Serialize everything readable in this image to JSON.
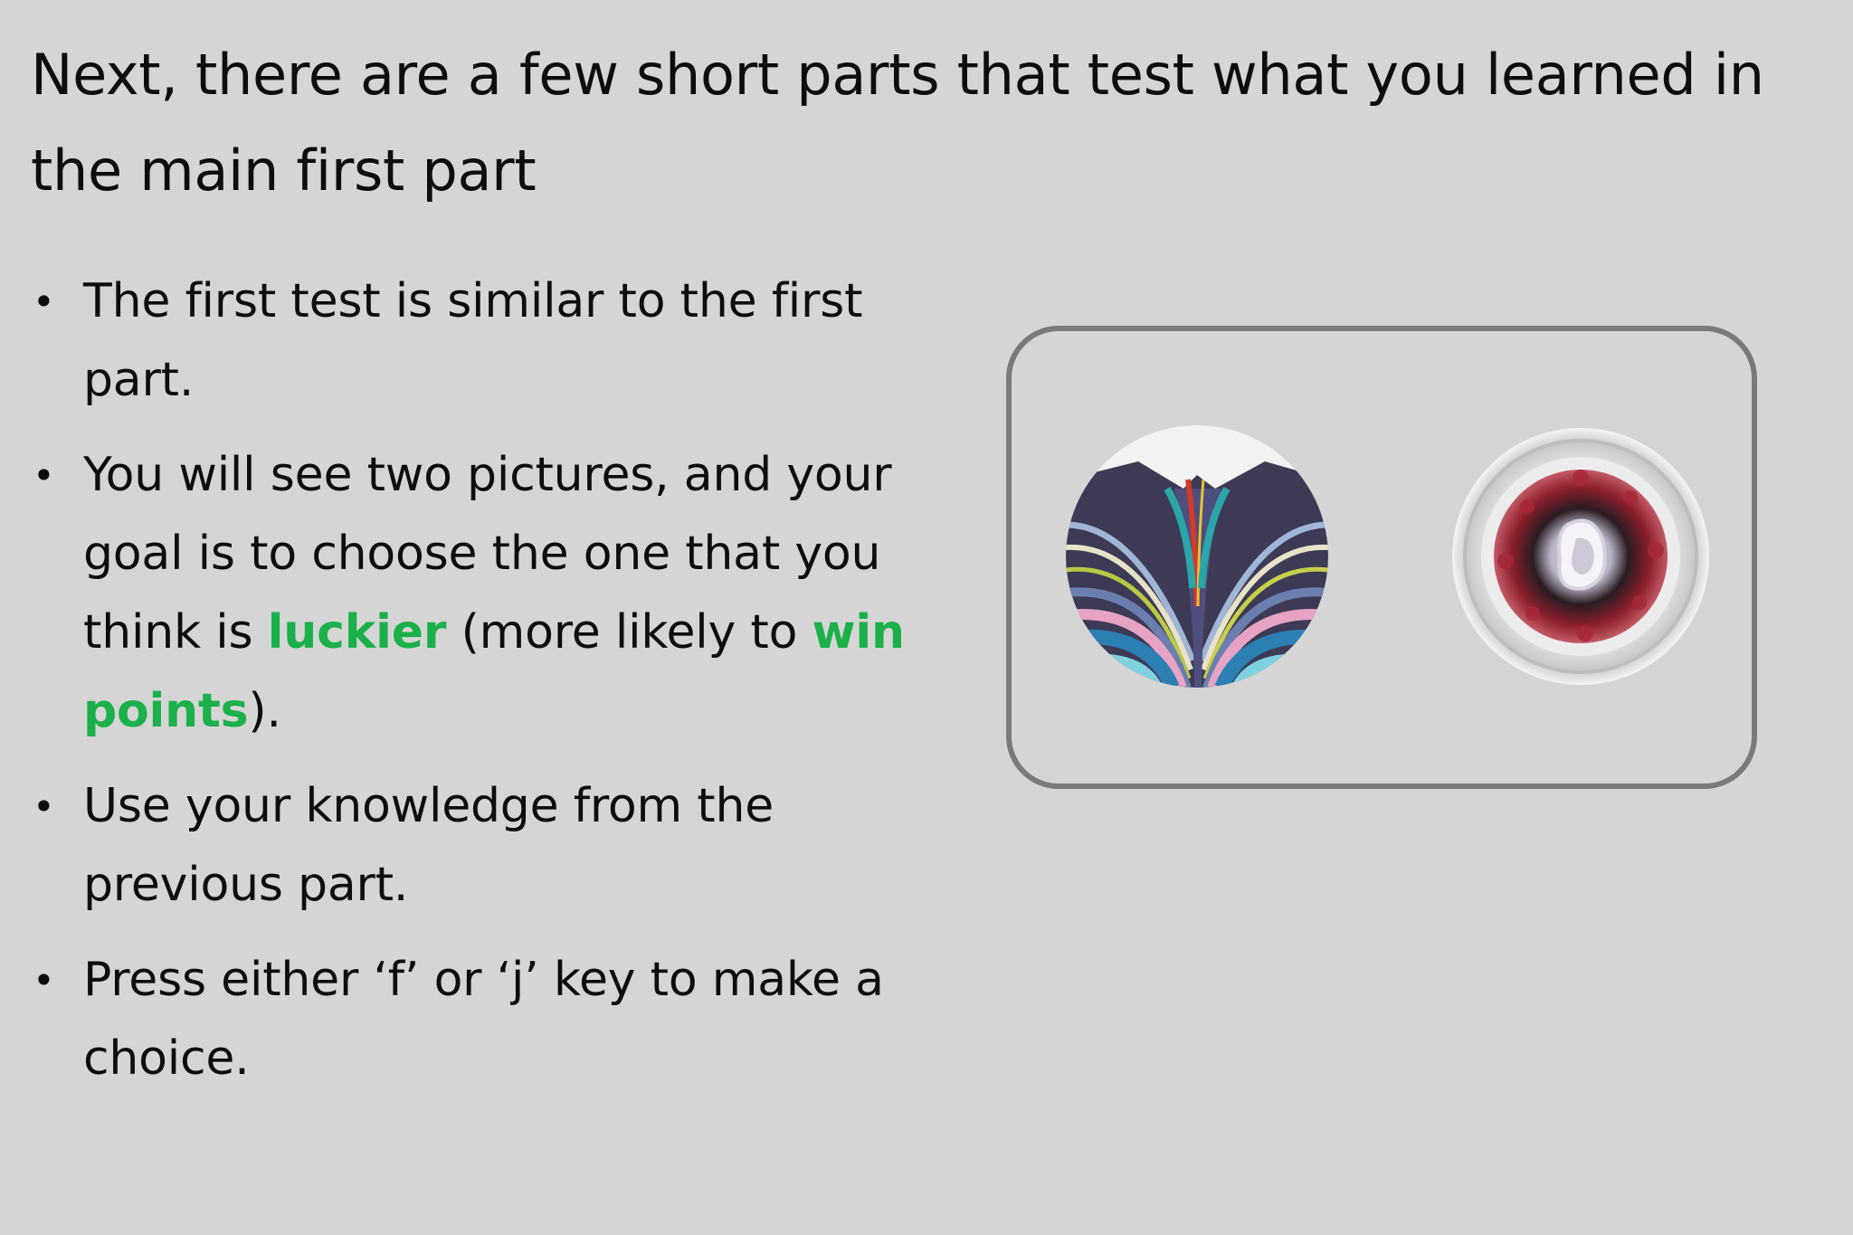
{
  "slide": {
    "title": "Next, there are a few short parts that test what you learned in the main first part",
    "bullets": [
      {
        "text": "The first test is similar to the first part."
      },
      {
        "text_before": "You will see two pictures, and your goal is to choose the one that you think is ",
        "highlight_1": "luckier",
        "text_middle": " (more likely to ",
        "highlight_2": "win points",
        "text_after": ")."
      },
      {
        "text": "Use your knowledge from the previous part."
      },
      {
        "text": "Press either ‘f’ or ‘j’ key to make a choice."
      }
    ],
    "bullet_glyph": "•"
  },
  "colors": {
    "background": "#d5d5d5",
    "text": "#0d0d0d",
    "accent": "#1bb04a",
    "frame_border": "#7a7a7a"
  },
  "stimuli": [
    {
      "name": "left-marbled-art-picture",
      "description_icon": "abstract-painting-image"
    },
    {
      "name": "right-crystal-dish-picture",
      "description_icon": "petri-dish-image"
    }
  ]
}
